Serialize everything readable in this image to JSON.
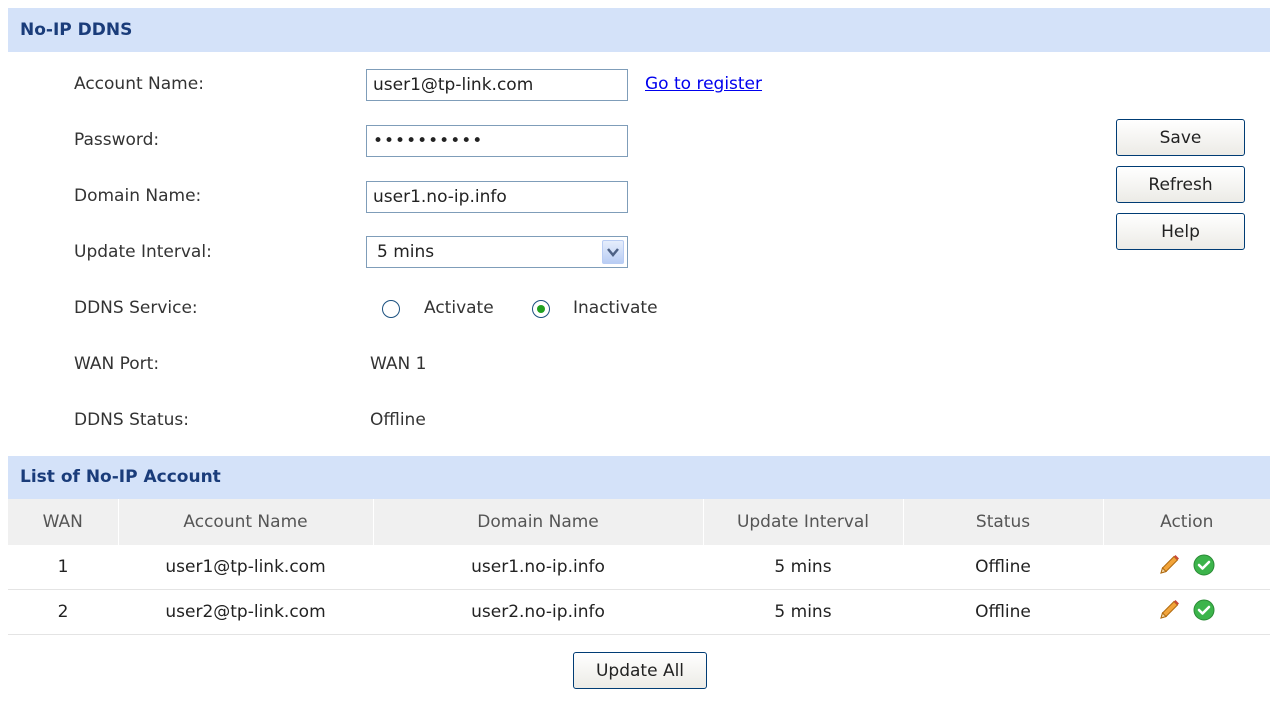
{
  "section_title": "No-IP DDNS",
  "form": {
    "account_label": "Account Name:",
    "account_value": "user1@tp-link.com",
    "register_link": "Go to register",
    "password_label": "Password:",
    "password_value": "••••••••••",
    "domain_label": "Domain Name:",
    "domain_value": "user1.no-ip.info",
    "interval_label": "Update Interval:",
    "interval_value": "5 mins",
    "service_label": "DDNS Service:",
    "service_options": [
      "Activate",
      "Inactivate"
    ],
    "service_selected": "Inactivate",
    "wan_label": "WAN Port:",
    "wan_value": "WAN 1",
    "status_label": "DDNS Status:",
    "status_value": "Offline"
  },
  "buttons": {
    "save": "Save",
    "refresh": "Refresh",
    "help": "Help",
    "update_all": "Update All"
  },
  "list": {
    "title": "List of No-IP Account",
    "columns": [
      "WAN",
      "Account Name",
      "Domain Name",
      "Update Interval",
      "Status",
      "Action"
    ],
    "rows": [
      {
        "wan": "1",
        "account": "user1@tp-link.com",
        "domain": "user1.no-ip.info",
        "interval": "5 mins",
        "status": "Offline"
      },
      {
        "wan": "2",
        "account": "user2@tp-link.com",
        "domain": "user2.no-ip.info",
        "interval": "5 mins",
        "status": "Offline"
      }
    ]
  },
  "icons": {
    "edit": "pencil-edit-icon",
    "enable": "green-check-icon"
  },
  "colors": {
    "header_bg": "#d4e2f9",
    "header_text": "#1a3c7a",
    "link": "#0000ee",
    "check_green": "#3cb44b"
  }
}
